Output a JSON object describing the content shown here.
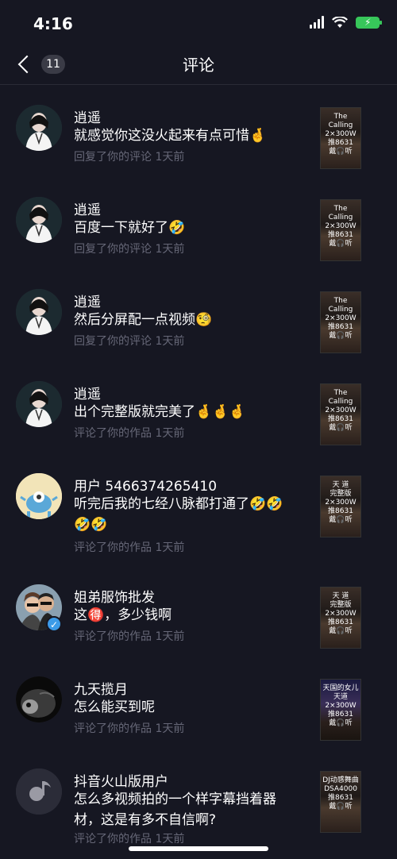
{
  "status": {
    "time": "4:16"
  },
  "nav": {
    "badge": "11",
    "title": "评论"
  },
  "items": [
    {
      "name": "逍遥",
      "text": "就感觉你这没火起来有点可惜🤞",
      "meta": "回复了你的评论  1天前",
      "thumb": [
        "The Calling",
        "2×300W",
        "推8631",
        "戴🎧听"
      ]
    },
    {
      "name": "逍遥",
      "text": "百度一下就好了🤣",
      "meta": "回复了你的评论  1天前",
      "thumb": [
        "The Calling",
        "2×300W",
        "推8631",
        "戴🎧听"
      ]
    },
    {
      "name": "逍遥",
      "text": "然后分屏配一点视频🧐",
      "meta": "回复了你的评论  1天前",
      "thumb": [
        "The Calling",
        "2×300W",
        "推8631",
        "戴🎧听"
      ]
    },
    {
      "name": "逍遥",
      "text": "出个完整版就完美了🤞🤞🤞",
      "meta": "评论了你的作品  1天前",
      "thumb": [
        "The Calling",
        "2×300W",
        "推8631",
        "戴🎧听"
      ]
    },
    {
      "name": "用户 5466374265410",
      "text": "听完后我的七经八脉都打通了🤣🤣🤣🤣",
      "meta": "评论了你的作品  1天前",
      "thumb": [
        "天 道",
        "完整版",
        "2×300W",
        "推8631",
        "戴🎧听"
      ]
    },
    {
      "name": "姐弟服饰批发",
      "text": "这🉐，多少钱啊",
      "meta": "评论了你的作品  1天前",
      "thumb": [
        "天 道",
        "完整版",
        "2×300W",
        "推8631",
        "戴🎧听"
      ]
    },
    {
      "name": "九天揽月",
      "text": "怎么能买到呢",
      "meta": "评论了你的作品  1天前",
      "thumb": [
        "天国的女儿",
        "天道",
        "2×300W",
        "推8631",
        "戴🎧听"
      ]
    },
    {
      "name": "抖音火山版用户",
      "text": "怎么多视频拍的一个样字幕挡着器材，这是有多不自信啊?",
      "meta": "评论了你的作品  1天前",
      "thumb": [
        "DJ动感舞曲",
        "DSA4000",
        "推8631",
        "戴🎧听"
      ]
    }
  ],
  "colors": {
    "background": "#161722",
    "meta_text": "#666777",
    "battery": "#37c65a"
  }
}
